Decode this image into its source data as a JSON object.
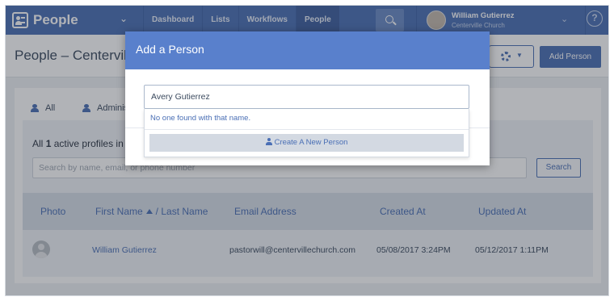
{
  "app": {
    "name": "People",
    "nav_tabs": [
      "Dashboard",
      "Lists",
      "Workflows",
      "People"
    ],
    "active_tab": "People",
    "user": {
      "name": "William Gutierrez",
      "org": "Centerville Church"
    },
    "help_label": "?"
  },
  "page": {
    "title": "People – Centerville Church",
    "add_person_label": "Add Person"
  },
  "tabs": [
    "All",
    "Administrators"
  ],
  "list": {
    "count_prefix": "All",
    "count_value": "1",
    "count_suffix": "active profiles in Centerville Church",
    "search_placeholder": "Search by name, email, or phone number",
    "search_button": "Search",
    "columns": [
      "Photo",
      "First Name",
      "/ Last Name",
      "Email Address",
      "Created At",
      "Updated At"
    ],
    "rows": [
      {
        "name": "William Gutierrez",
        "email": "pastorwill@centervillechurch.com",
        "created": "05/08/2017 3:24PM",
        "updated": "05/12/2017 1:11PM"
      }
    ]
  },
  "modal": {
    "title": "Add a Person",
    "input_value": "Avery Gutierrez",
    "no_results": "No one found with that name.",
    "create_label": "Create A New Person"
  },
  "colors": {
    "nav": "#4a6fb5",
    "modal_header": "#5980cc",
    "link": "#4a6fb5"
  }
}
